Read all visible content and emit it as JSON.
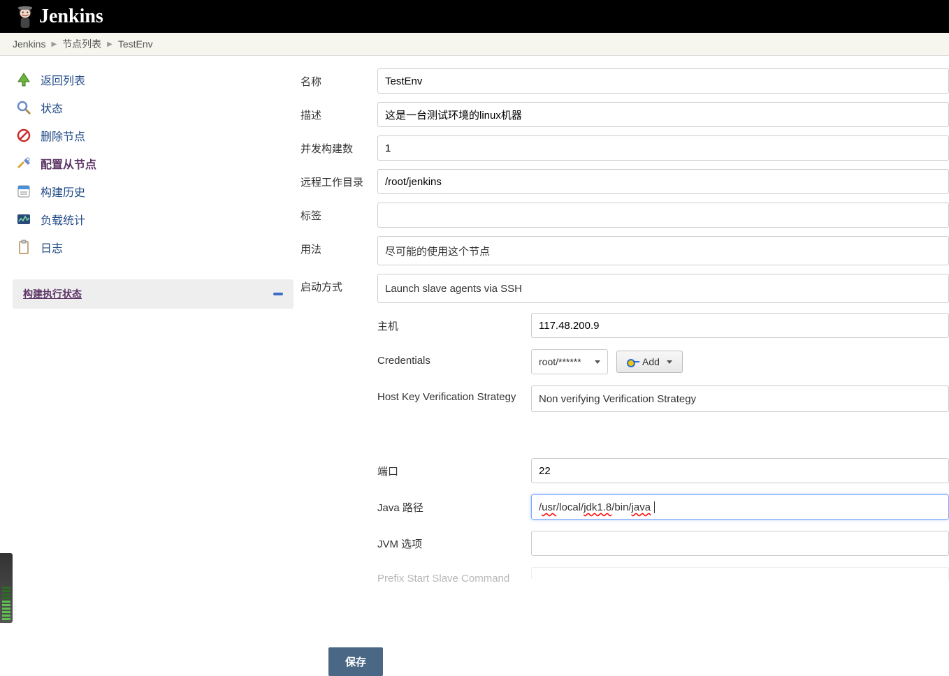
{
  "header": {
    "title": "Jenkins"
  },
  "breadcrumb": {
    "items": [
      "Jenkins",
      "节点列表",
      "TestEnv"
    ]
  },
  "sidebar": {
    "items": [
      {
        "label": "返回列表"
      },
      {
        "label": "状态"
      },
      {
        "label": "删除节点"
      },
      {
        "label": "配置从节点"
      },
      {
        "label": "构建历史"
      },
      {
        "label": "负载统计"
      },
      {
        "label": "日志"
      }
    ],
    "executor_title": "构建执行状态"
  },
  "form": {
    "name_label": "名称",
    "name_value": "TestEnv",
    "desc_label": "描述",
    "desc_value": "这是一台测试环境的linux机器",
    "executors_label": "并发构建数",
    "executors_value": "1",
    "remote_label": "远程工作目录",
    "remote_value": "/root/jenkins",
    "tags_label": "标签",
    "tags_value": "",
    "usage_label": "用法",
    "usage_value": "尽可能的使用这个节点",
    "launch_label": "启动方式",
    "launch_value": "Launch slave agents via SSH",
    "host_label": "主机",
    "host_value": "117.48.200.9",
    "cred_label": "Credentials",
    "cred_value": "root/******",
    "add_label": "Add",
    "hostkey_label": "Host Key Verification Strategy",
    "hostkey_value": "Non verifying Verification Strategy",
    "port_label": "端口",
    "port_value": "22",
    "java_label": "Java 路径",
    "java_pre": "/",
    "java_s1": "usr",
    "java_mid1": "/local/",
    "java_s2": "jdk1.8",
    "java_mid2": "/bin/",
    "java_s3": "java",
    "jvm_label": "JVM 选项",
    "jvm_value": "",
    "prefix_label": "Prefix Start Slave Command",
    "save": "保存"
  }
}
